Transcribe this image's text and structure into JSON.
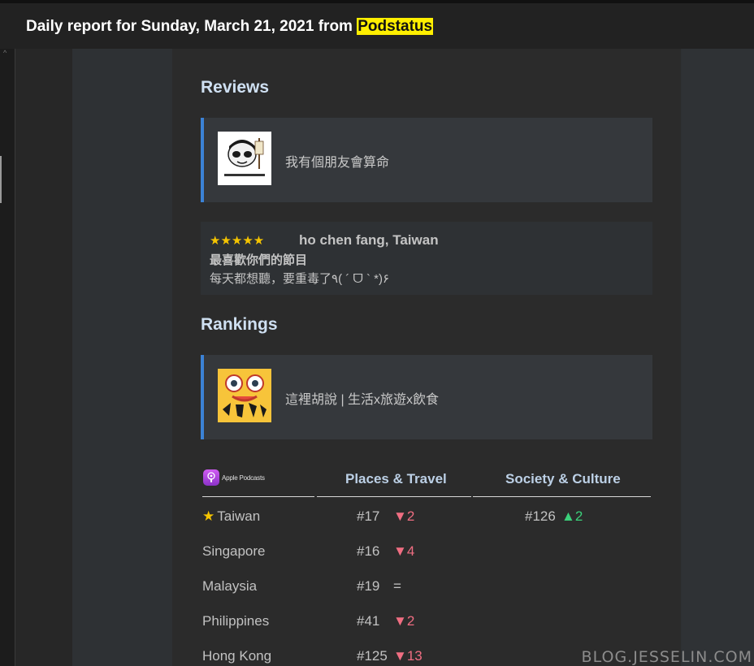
{
  "header": {
    "title_prefix": "Daily report for Sunday, March 21, 2021 from",
    "source": "Podstatus"
  },
  "reviews": {
    "heading": "Reviews",
    "podcast_name": "我有個朋友會算命",
    "review": {
      "stars": "★★★★★",
      "rating": 5,
      "reviewer": "ho chen fang, Taiwan",
      "title": "最喜歡你們的節目",
      "body": "每天都想聽，要重毒了٩( ´ ᗜ ` *)۶"
    }
  },
  "rankings": {
    "heading": "Rankings",
    "podcast_name": "這裡胡說 | 生活x旅遊x飲食",
    "platform_label": "Apple Podcasts",
    "columns": [
      "Places & Travel",
      "Society & Culture"
    ],
    "rows": [
      {
        "country": "Taiwan",
        "featured": "★",
        "c1_rank": "#17",
        "c1_change": "▼2",
        "c1_dir": "down",
        "c2_rank": "#126",
        "c2_change": "▲2",
        "c2_dir": "up"
      },
      {
        "country": "Singapore",
        "c1_rank": "#16",
        "c1_change": "▼4",
        "c1_dir": "down"
      },
      {
        "country": "Malaysia",
        "c1_rank": "#19",
        "c1_change": "=",
        "c1_dir": "eq"
      },
      {
        "country": "Philippines",
        "c1_rank": "#41",
        "c1_change": "▼2",
        "c1_dir": "down"
      },
      {
        "country": "Hong Kong",
        "c1_rank": "#125",
        "c1_change": "▼13",
        "c1_dir": "down"
      }
    ]
  },
  "watermark": "BLOG.JESSELIN.COM",
  "colors": {
    "accent_border": "#3b82d6",
    "highlight": "#ffef00",
    "down": "#f06e82",
    "up": "#3bd07a",
    "star": "#f5c400"
  }
}
